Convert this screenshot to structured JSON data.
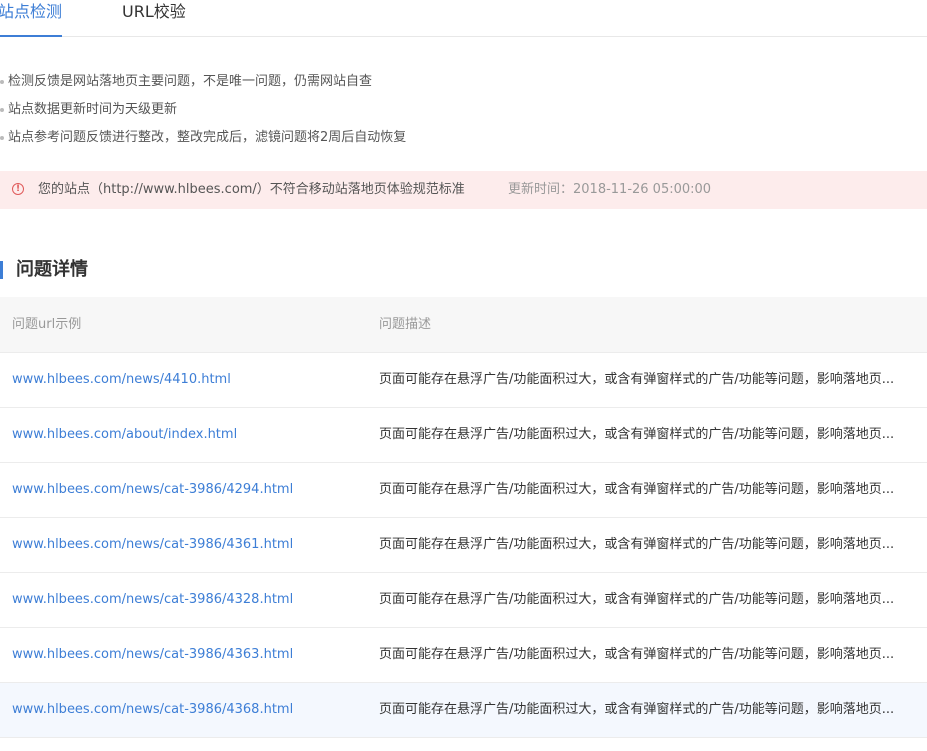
{
  "tabs": [
    {
      "label": "站点检测",
      "active": true
    },
    {
      "label": "URL校验",
      "active": false
    }
  ],
  "notes": [
    "检测反馈是网站落地页主要问题，不是唯一问题，仍需网站自查",
    "站点数据更新时间为天级更新",
    "站点参考问题反馈进行整改，整改完成后，滤镜问题将2周后自动恢复"
  ],
  "alert": {
    "icon": "exclamation-circle-icon",
    "message": "您的站点（http://www.hlbees.com/）不符合移动站落地页体验规范标准",
    "update_time": "更新时间：2018-11-26 05:00:00"
  },
  "section": {
    "title": "问题详情"
  },
  "table": {
    "headers": [
      "问题url示例",
      "问题描述"
    ],
    "rows": [
      {
        "url": "www.hlbees.com/news/4410.html",
        "desc": "页面可能存在悬浮广告/功能面积过大，或含有弹窗样式的广告/功能等问题，影响落地页..."
      },
      {
        "url": "www.hlbees.com/about/index.html",
        "desc": "页面可能存在悬浮广告/功能面积过大，或含有弹窗样式的广告/功能等问题，影响落地页..."
      },
      {
        "url": "www.hlbees.com/news/cat-3986/4294.html",
        "desc": "页面可能存在悬浮广告/功能面积过大，或含有弹窗样式的广告/功能等问题，影响落地页..."
      },
      {
        "url": "www.hlbees.com/news/cat-3986/4361.html",
        "desc": "页面可能存在悬浮广告/功能面积过大，或含有弹窗样式的广告/功能等问题，影响落地页..."
      },
      {
        "url": "www.hlbees.com/news/cat-3986/4328.html",
        "desc": "页面可能存在悬浮广告/功能面积过大，或含有弹窗样式的广告/功能等问题，影响落地页..."
      },
      {
        "url": "www.hlbees.com/news/cat-3986/4363.html",
        "desc": "页面可能存在悬浮广告/功能面积过大，或含有弹窗样式的广告/功能等问题，影响落地页..."
      },
      {
        "url": "www.hlbees.com/news/cat-3986/4368.html",
        "desc": "页面可能存在悬浮广告/功能面积过大，或含有弹窗样式的广告/功能等问题，影响落地页..."
      }
    ]
  },
  "colors": {
    "accent": "#3d7ed6",
    "alert_bg": "#fdecec",
    "alert_icon": "#e05a5a"
  }
}
